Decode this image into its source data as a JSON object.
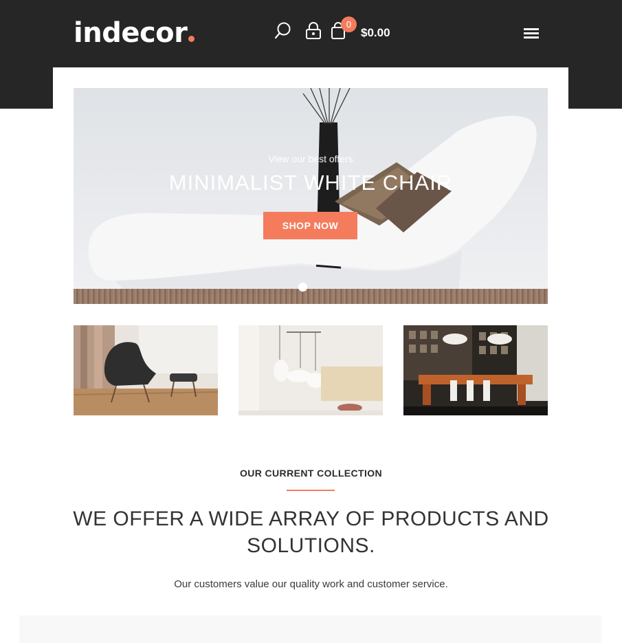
{
  "brand": {
    "name": "indecor",
    "accent": "#f47c5d",
    "header_bg": "#262626"
  },
  "header": {
    "cart_count": "0",
    "cart_total": "$0.00",
    "icons": [
      "search-icon",
      "lock-icon",
      "shopping-bag-icon",
      "menu-icon"
    ]
  },
  "hero": {
    "eyebrow": "View our best offers",
    "title": "MINIMALIST WHITE CHAIR",
    "cta": "SHOP NOW",
    "slides_total": 1
  },
  "collection": {
    "eyebrow": "OUR CURRENT COLLECTION",
    "headline": "WE OFFER A WIDE ARRAY OF PRODUCTS AND SOLUTIONS.",
    "subline": "Our customers value our quality work and customer service."
  }
}
